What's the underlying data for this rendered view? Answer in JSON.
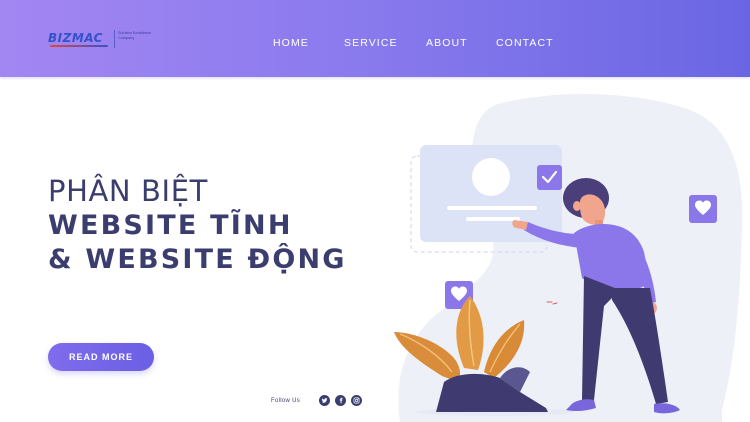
{
  "header": {
    "logo": {
      "brand": "BIZMAC",
      "tagline": "Solution Excellence Company"
    },
    "nav": [
      {
        "label": "HOME"
      },
      {
        "label": "SERVICE"
      },
      {
        "label": "ABOUT"
      },
      {
        "label": "CONTACT"
      }
    ]
  },
  "hero": {
    "line1": "PHÂN BIỆT",
    "line2": "WEBSITE TĨNH",
    "line3": "& WEBSITE ĐỘNG",
    "cta_label": "READ MORE"
  },
  "social": {
    "follow_label": "Follow Us",
    "icons": [
      "twitter-icon",
      "facebook-icon",
      "instagram-icon"
    ]
  },
  "colors": {
    "header_start": "#a386f2",
    "header_end": "#6a66e3",
    "heading_text": "#3b3d6e",
    "button": "#7466e8",
    "accent_purple": "#8c77ea",
    "plant_orange": "#d98c3a"
  }
}
